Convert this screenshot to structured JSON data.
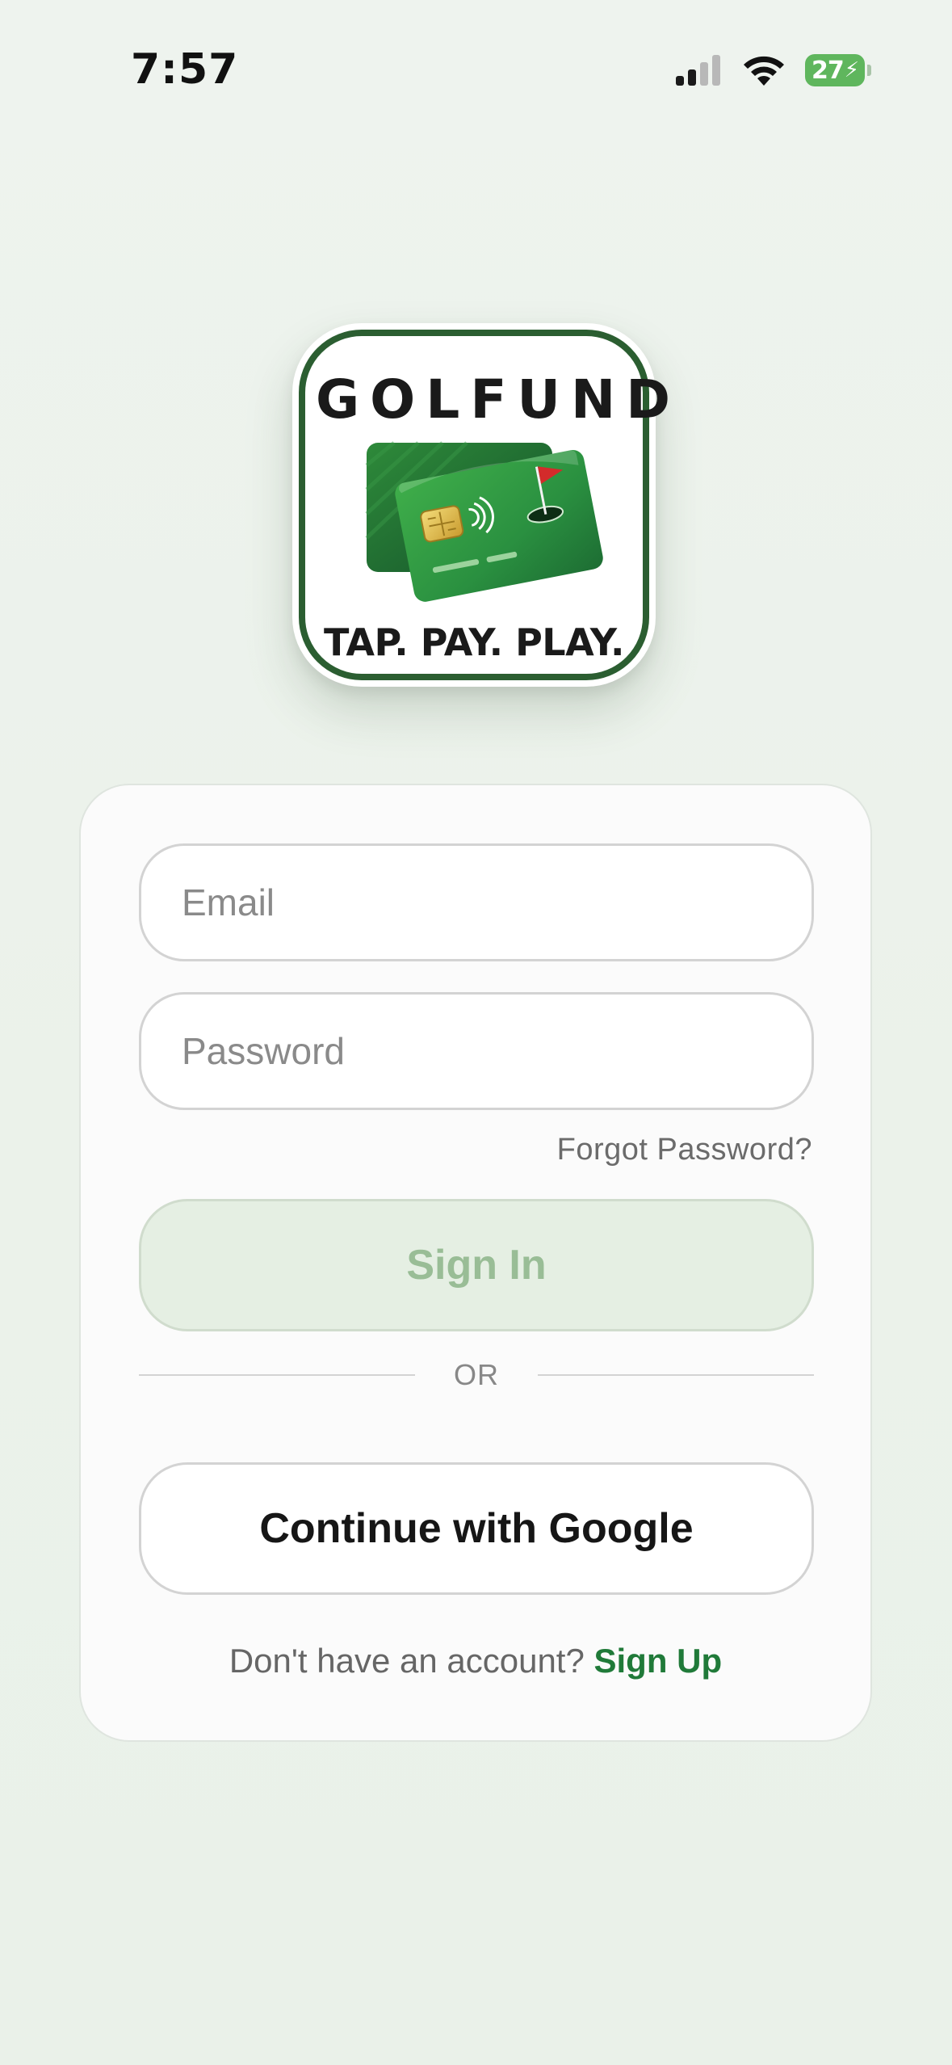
{
  "status_bar": {
    "time": "7:57",
    "battery_level": "27",
    "icons": [
      "signal-icon",
      "wifi-icon",
      "battery-charging-icon"
    ]
  },
  "logo": {
    "title": "GOLFUND",
    "tagline": "TAP. PAY. PLAY.",
    "art": "green-payment-cards-with-golf-flag",
    "colors": {
      "border": "#2b5e31",
      "card_green": "#2f9a3f",
      "flag_red": "#d32b2b"
    }
  },
  "form": {
    "email": {
      "placeholder": "Email",
      "value": ""
    },
    "password": {
      "placeholder": "Password",
      "value": ""
    },
    "forgot_password": "Forgot Password?",
    "sign_in": "Sign In",
    "divider": "OR",
    "google": "Continue with Google",
    "signup_prompt": "Don't have an account?",
    "signup_link": "Sign Up"
  },
  "colors": {
    "accent": "#207a39",
    "disabled_button_bg": "#e5efe3",
    "disabled_button_text": "#99bd96",
    "background": "#edf3ec"
  }
}
